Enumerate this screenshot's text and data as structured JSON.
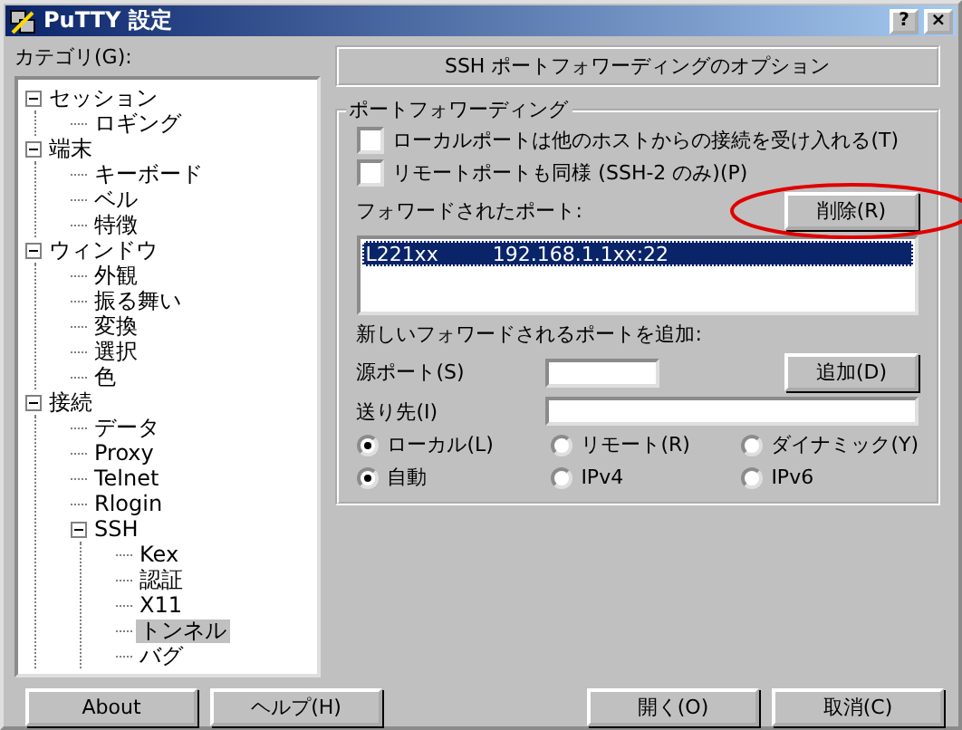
{
  "window": {
    "title": "PuTTY 設定",
    "controls": [
      "?",
      "×"
    ]
  },
  "category_label": "カテゴリ(G):",
  "tree": [
    {
      "label": "セッション",
      "expanded": true,
      "selected": false,
      "children": [
        {
          "label": "ロギング",
          "selected": false
        }
      ]
    },
    {
      "label": "端末",
      "expanded": true,
      "selected": false,
      "children": [
        {
          "label": "キーボード",
          "selected": false
        },
        {
          "label": "ベル",
          "selected": false
        },
        {
          "label": "特徴",
          "selected": false
        }
      ]
    },
    {
      "label": "ウィンドウ",
      "expanded": true,
      "selected": false,
      "children": [
        {
          "label": "外観",
          "selected": false
        },
        {
          "label": "振る舞い",
          "selected": false
        },
        {
          "label": "変換",
          "selected": false
        },
        {
          "label": "選択",
          "selected": false
        },
        {
          "label": "色",
          "selected": false
        }
      ]
    },
    {
      "label": "接続",
      "expanded": true,
      "selected": false,
      "children": [
        {
          "label": "データ",
          "selected": false
        },
        {
          "label": "Proxy",
          "selected": false
        },
        {
          "label": "Telnet",
          "selected": false
        },
        {
          "label": "Rlogin",
          "selected": false
        },
        {
          "label": "SSH",
          "expanded": true,
          "selected": false,
          "children": [
            {
              "label": "Kex",
              "selected": false
            },
            {
              "label": "認証",
              "selected": false
            },
            {
              "label": "X11",
              "selected": false
            },
            {
              "label": "トンネル",
              "selected": true
            },
            {
              "label": "バグ",
              "selected": false
            }
          ]
        }
      ]
    }
  ],
  "panel": {
    "header": "SSH ポートフォワーディングのオプション",
    "group_title": "ポートフォワーディング",
    "checkboxes": [
      {
        "label": "ローカルポートは他のホストからの接続を受け入れる(T)",
        "checked": false
      },
      {
        "label": "リモートポートも同様 (SSH-2 のみ)(P)",
        "checked": false
      }
    ],
    "forwarded_label": "フォワードされたポート:",
    "remove_button": "削除(R)",
    "forwarded_ports": [
      {
        "source": "L221xx",
        "destination": "192.168.1.1xx:22",
        "selected": true
      }
    ],
    "add_label": "新しいフォワードされるポートを追加:",
    "source_port_label": "源ポート(S)",
    "add_button": "追加(D)",
    "destination_label": "送り先(I)",
    "direction_options": [
      {
        "label": "ローカル(L)",
        "selected": true
      },
      {
        "label": "リモート(R)",
        "selected": false
      },
      {
        "label": "ダイナミック(Y)",
        "selected": false
      }
    ],
    "ip_options": [
      {
        "label": "自動",
        "selected": true
      },
      {
        "label": "IPv4",
        "selected": false
      },
      {
        "label": "IPv6",
        "selected": false
      }
    ]
  },
  "buttons": [
    {
      "label": "About",
      "kind": "left"
    },
    {
      "label": "ヘルプ(H)",
      "kind": "left"
    },
    {
      "label": "開く(O)",
      "kind": "right"
    },
    {
      "label": "取消(C)",
      "kind": "right"
    }
  ]
}
